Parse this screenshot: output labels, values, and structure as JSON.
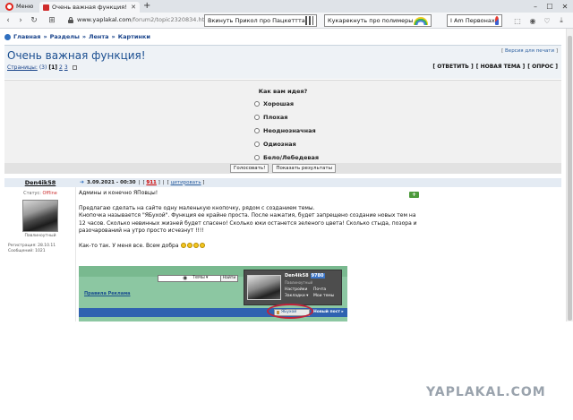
{
  "browser": {
    "menu_label": "Меню",
    "tab_title": "Очень важная функция!",
    "url_host": "www.yaplakal.com",
    "url_path": "/forum2/topic2320834.html",
    "ads": [
      {
        "label": "Вкинуть Прикол про Пацкеттта"
      },
      {
        "label": "Кукарекнуть про полимеры"
      },
      {
        "label": "I Am Первонах"
      }
    ]
  },
  "breadcrumb": [
    "Главная",
    "Разделы",
    "Лента",
    "Картинки"
  ],
  "topic": {
    "title": "Очень важная функция!",
    "print_link": "Версия для печати",
    "pages_label": "Страницы:",
    "pages_total": "(3)",
    "current_page": "[1]",
    "page_links": [
      "2",
      "3"
    ],
    "actions": [
      "ОТВЕТИТЬ",
      "НОВАЯ ТЕМА",
      "ОПРОС"
    ]
  },
  "poll": {
    "question": "Как вам идея?",
    "options": [
      "Хорошая",
      "Плохая",
      "Неоднозначная",
      "Одиозная",
      "Бело/Лебедевая"
    ],
    "vote_button": "Голосовать!",
    "results_button": "Показать результаты"
  },
  "post": {
    "author": "Den4ik58",
    "date": "3.09.2021 - 00:30",
    "post_number": "911",
    "quote_link": "цитировать",
    "status_label": "Статус:",
    "status_value": "Offline",
    "avatar_caption": "Павлиноутный",
    "registered": "Регистрация: 28.10.11",
    "messages": "Сообщений: 1021",
    "plus_label": "+",
    "paragraphs": [
      "Админы и конечно ЯПовцы!",
      "Предлагаю сделать на сайте одну маленькую кнопочку, рядом с созданием темы.",
      "Кнопочка называется \"ЯБухой\". Функция ее крайне проста. После нажатия, будет запрещено создание новых тем на",
      "12 часов. Сколько невинных жизней будет спасено! Сколько юки останется зеленого цвета! Сколько стыда, позора и",
      "разочарований на утро просто исчезнут !!!!",
      "Как-то так. У меня все. Всем добра"
    ]
  },
  "embedded_screenshot": {
    "topics_label": "Темы",
    "go_button": "Найти",
    "links": "Правила  Реклама",
    "nick": "Den4ik58",
    "nick_badge": "9780",
    "subtitle": "Павлиноутный",
    "menu": [
      [
        "Настройки",
        "Почта"
      ],
      [
        "Закладки ▾",
        "Мои темы"
      ]
    ],
    "yabuk_button": "ЯБухой",
    "newpost_label": "Новый пост ▸"
  },
  "watermark": "YAPLAKAL.COM"
}
